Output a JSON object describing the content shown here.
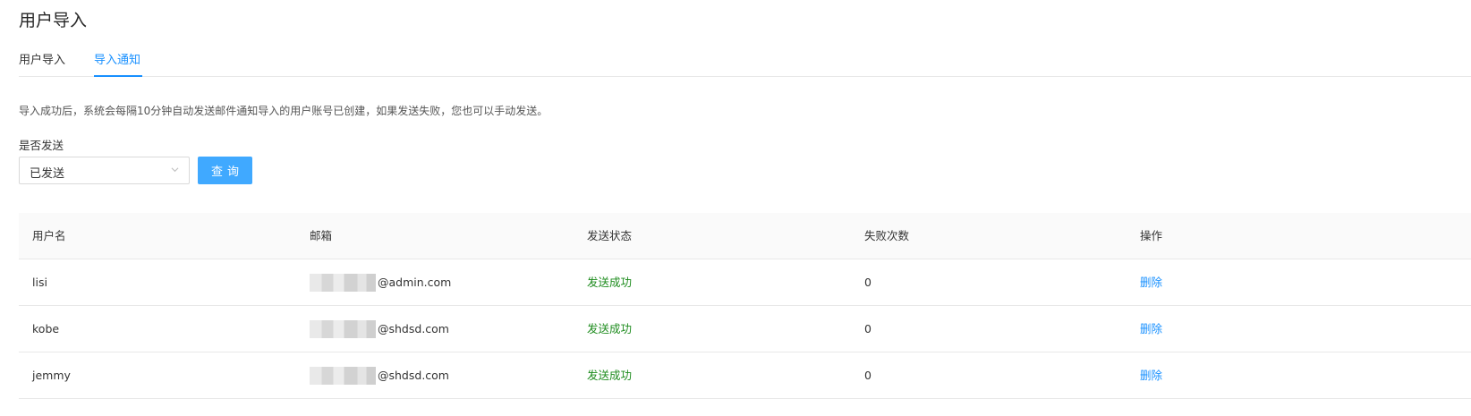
{
  "page": {
    "title": "用户导入"
  },
  "tabs": [
    {
      "label": "用户导入",
      "active": false
    },
    {
      "label": "导入通知",
      "active": true
    }
  ],
  "notice": "导入成功后，系统会每隔10分钟自动发送邮件通知导入的用户账号已创建，如果发送失败，您也可以手动发送。",
  "filter": {
    "label": "是否发送",
    "selected": "已发送",
    "query_button": "查询"
  },
  "table": {
    "columns": [
      "用户名",
      "邮箱",
      "发送状态",
      "失败次数",
      "操作"
    ],
    "rows": [
      {
        "username": "lisi",
        "email_domain": "@admin.com",
        "status": "发送成功",
        "fail_count": "0",
        "action": "删除"
      },
      {
        "username": "kobe",
        "email_domain": "@shdsd.com",
        "status": "发送成功",
        "fail_count": "0",
        "action": "删除"
      },
      {
        "username": "jemmy",
        "email_domain": "@shdsd.com",
        "status": "发送成功",
        "fail_count": "0",
        "action": "删除"
      }
    ]
  },
  "colors": {
    "accent": "#1890ff",
    "button_bg": "#40a9ff",
    "success": "#1e8c1e"
  },
  "icons": {
    "select_arrow": "chevron-down-icon"
  }
}
